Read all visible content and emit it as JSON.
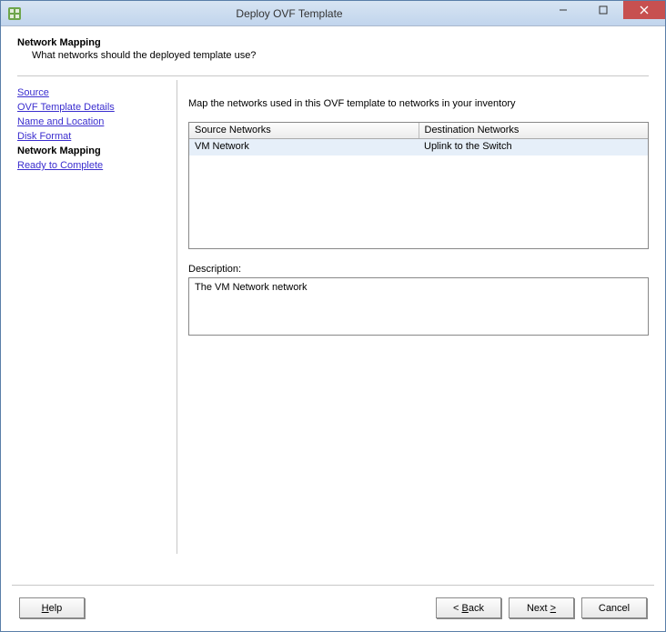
{
  "window": {
    "title": "Deploy OVF Template"
  },
  "header": {
    "title": "Network Mapping",
    "subtitle": "What networks should the deployed template use?"
  },
  "sidebar": {
    "items": [
      {
        "label": "Source",
        "current": false
      },
      {
        "label": "OVF Template Details",
        "current": false
      },
      {
        "label": "Name and Location",
        "current": false
      },
      {
        "label": "Disk Format",
        "current": false
      },
      {
        "label": "Network Mapping",
        "current": true
      },
      {
        "label": "Ready to Complete",
        "current": false
      }
    ]
  },
  "main": {
    "instruction": "Map the networks used in this OVF template to networks in your inventory",
    "table": {
      "columns": [
        "Source Networks",
        "Destination Networks"
      ],
      "rows": [
        {
          "source": "VM Network",
          "destination": "Uplink to the Switch"
        }
      ]
    },
    "description_label": "Description:",
    "description_text": "The VM Network network"
  },
  "footer": {
    "help": "Help",
    "back": "< Back",
    "next": "Next >",
    "cancel": "Cancel"
  }
}
